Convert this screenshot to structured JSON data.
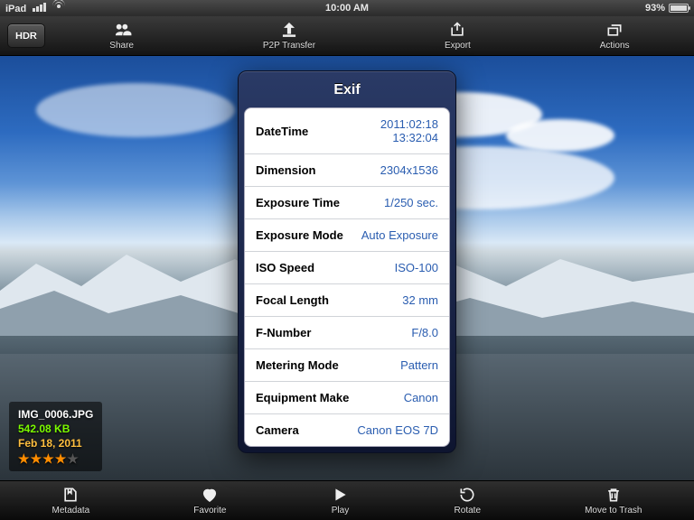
{
  "statusbar": {
    "device": "iPad",
    "time": "10:00 AM",
    "battery_pct": "93%"
  },
  "top_toolbar": {
    "hdr_label": "HDR",
    "items": [
      {
        "label": "Share"
      },
      {
        "label": "P2P Transfer"
      },
      {
        "label": "Export"
      },
      {
        "label": "Actions"
      }
    ]
  },
  "bottom_toolbar": {
    "items": [
      {
        "label": "Metadata"
      },
      {
        "label": "Favorite"
      },
      {
        "label": "Play"
      },
      {
        "label": "Rotate"
      },
      {
        "label": "Move to Trash"
      }
    ]
  },
  "file_info": {
    "filename": "IMG_0006.JPG",
    "filesize": "542.08 KB",
    "filedate": "Feb 18, 2011",
    "rating_stars": 4,
    "rating_out_of": 5
  },
  "exif_panel": {
    "title": "Exif",
    "rows": [
      {
        "label": "DateTime",
        "value": "2011:02:18 13:32:04"
      },
      {
        "label": "Dimension",
        "value": "2304x1536"
      },
      {
        "label": "Exposure Time",
        "value": "1/250 sec."
      },
      {
        "label": "Exposure Mode",
        "value": "Auto Exposure"
      },
      {
        "label": "ISO Speed",
        "value": "ISO-100"
      },
      {
        "label": "Focal Length",
        "value": "32 mm"
      },
      {
        "label": "F-Number",
        "value": "F/8.0"
      },
      {
        "label": "Metering Mode",
        "value": "Pattern"
      },
      {
        "label": "Equipment Make",
        "value": "Canon"
      },
      {
        "label": "Camera",
        "value": "Canon EOS 7D"
      }
    ]
  },
  "colors": {
    "link_blue": "#2a5db0",
    "rating_orange": "#ff8c00",
    "size_green": "#7CFC00",
    "date_amber": "#ffbf3f"
  }
}
